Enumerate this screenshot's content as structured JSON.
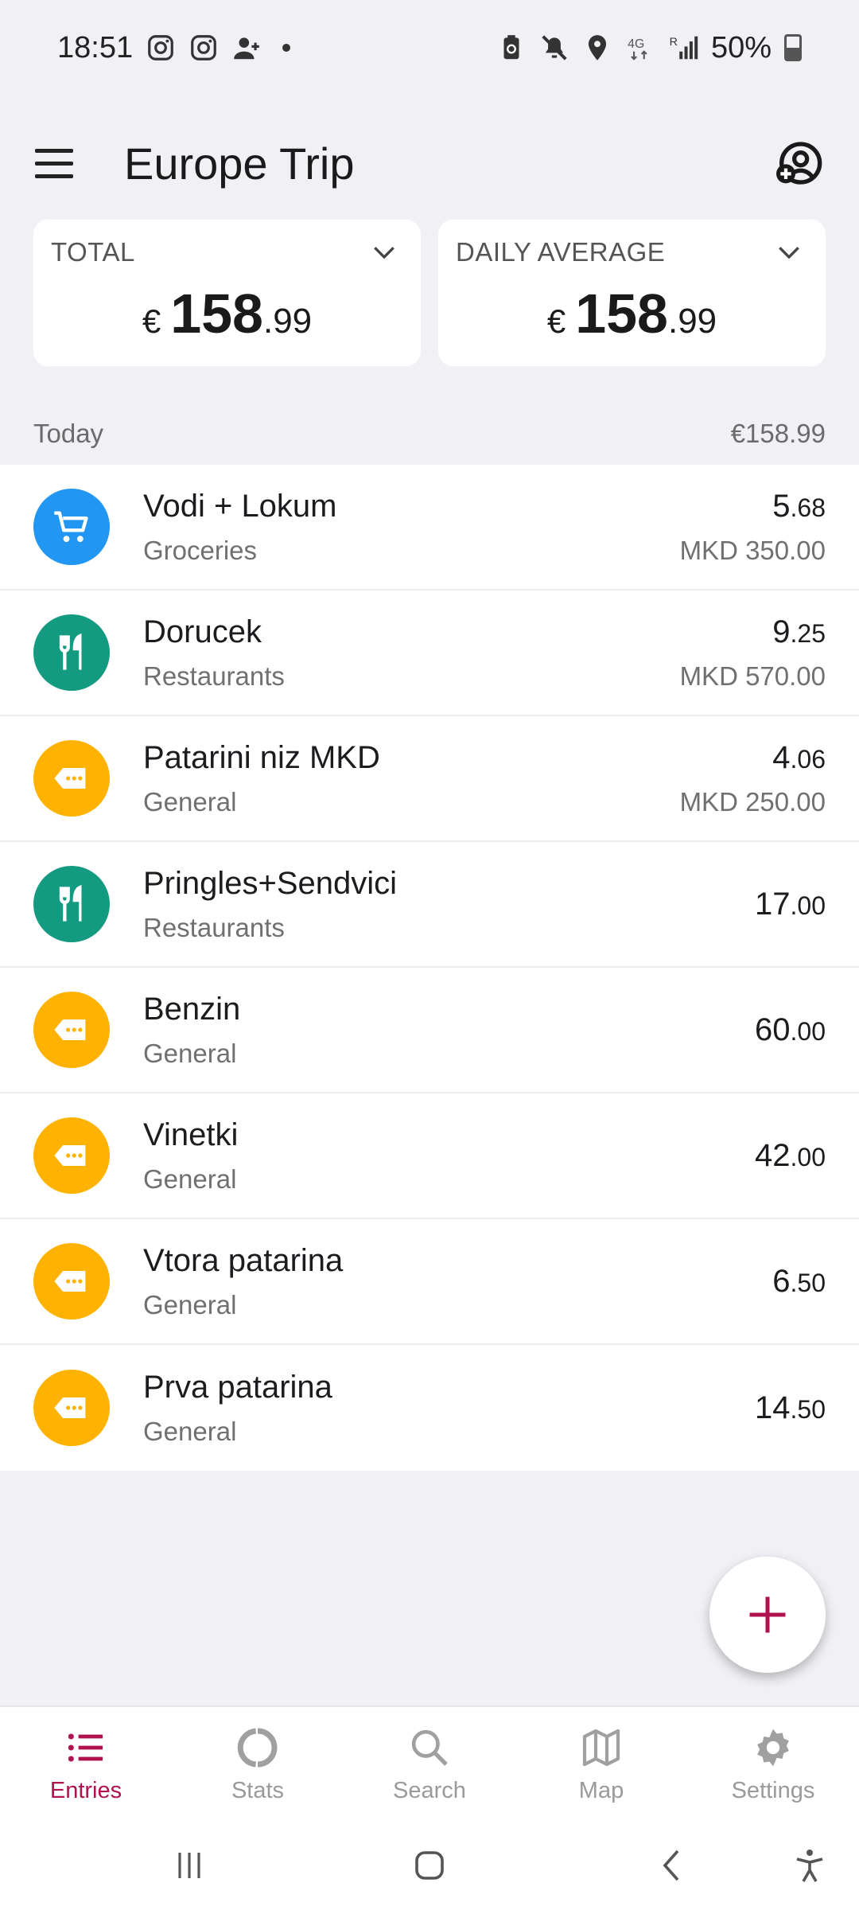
{
  "status_bar": {
    "time": "18:51",
    "battery": "50%",
    "left_icons": [
      "instagram-icon",
      "instagram-icon",
      "person-add-icon"
    ],
    "right_icons": [
      "battery-saver-icon",
      "mute-icon",
      "location-icon",
      "4g-icon",
      "signal-icon"
    ]
  },
  "app_bar": {
    "title": "Europe Trip",
    "menu_icon": "menu-icon",
    "account_icon": "account-add-icon"
  },
  "summary": {
    "total": {
      "label": "TOTAL",
      "currency": "€",
      "int": "158",
      "dec": ".99"
    },
    "daily": {
      "label": "DAILY AVERAGE",
      "currency": "€",
      "int": "158",
      "dec": ".99"
    }
  },
  "section": {
    "label": "Today",
    "total": "€158.99"
  },
  "entries": [
    {
      "title": "Vodi + Lokum",
      "category": "Groceries",
      "int": "5",
      "dec": ".68",
      "orig": "MKD 350.00",
      "icon": "cart-icon",
      "color": "#2196f3"
    },
    {
      "title": "Dorucek",
      "category": "Restaurants",
      "int": "9",
      "dec": ".25",
      "orig": "MKD 570.00",
      "icon": "cutlery-icon",
      "color": "#139b81"
    },
    {
      "title": "Patarini niz MKD",
      "category": "General",
      "int": "4",
      "dec": ".06",
      "orig": "MKD 250.00",
      "icon": "tag-icon",
      "color": "#ffb300"
    },
    {
      "title": "Pringles+Sendvici",
      "category": "Restaurants",
      "int": "17",
      "dec": ".00",
      "orig": "",
      "icon": "cutlery-icon",
      "color": "#139b81"
    },
    {
      "title": "Benzin",
      "category": "General",
      "int": "60",
      "dec": ".00",
      "orig": "",
      "icon": "tag-icon",
      "color": "#ffb300"
    },
    {
      "title": "Vinetki",
      "category": "General",
      "int": "42",
      "dec": ".00",
      "orig": "",
      "icon": "tag-icon",
      "color": "#ffb300"
    },
    {
      "title": "Vtora patarina",
      "category": "General",
      "int": "6",
      "dec": ".50",
      "orig": "",
      "icon": "tag-icon",
      "color": "#ffb300"
    },
    {
      "title": "Prva patarina",
      "category": "General",
      "int": "14",
      "dec": ".50",
      "orig": "",
      "icon": "tag-icon",
      "color": "#ffb300"
    }
  ],
  "fab": {
    "icon": "plus-icon",
    "color": "#b0124f"
  },
  "bottom_nav": [
    {
      "label": "Entries",
      "icon": "list-icon",
      "active": true
    },
    {
      "label": "Stats",
      "icon": "donut-icon",
      "active": false
    },
    {
      "label": "Search",
      "icon": "search-icon",
      "active": false
    },
    {
      "label": "Map",
      "icon": "map-icon",
      "active": false
    },
    {
      "label": "Settings",
      "icon": "gear-icon",
      "active": false
    }
  ],
  "colors": {
    "accent": "#b0124f",
    "background": "#f0f0f5"
  }
}
